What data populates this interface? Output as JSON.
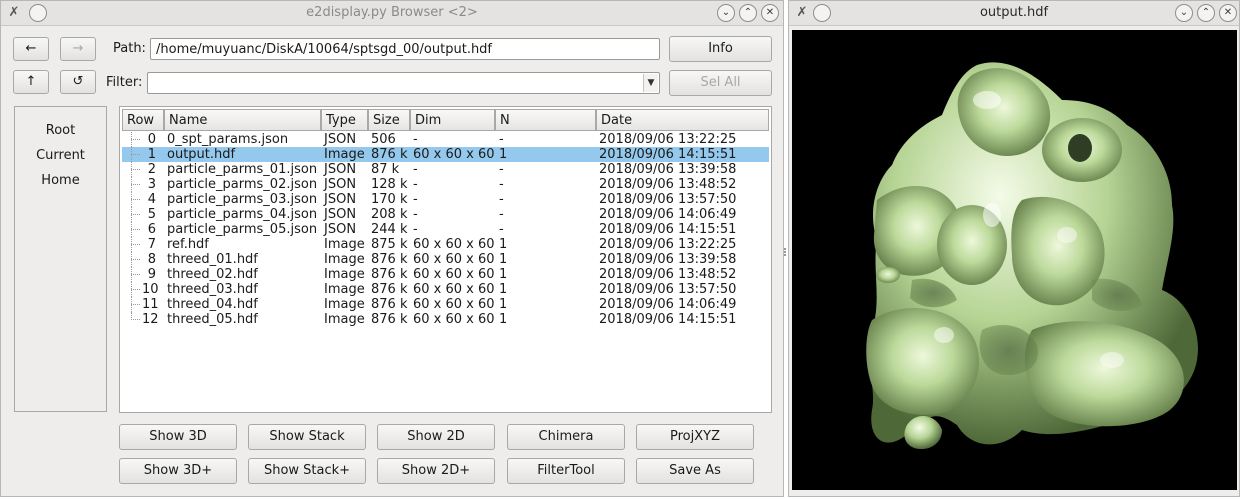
{
  "browser": {
    "title": "e2display.py Browser <2>",
    "back_icon": "←",
    "forward_icon": "→",
    "up_icon": "↑",
    "refresh_icon": "↺",
    "path_label": "Path:",
    "path_value": "/home/muyuanc/DiskA/10064/sptsgd_00/output.hdf",
    "info_label": "Info",
    "filter_label": "Filter:",
    "filter_value": "",
    "sel_all_label": "Sel All",
    "nav_items": [
      "Root",
      "Current",
      "Home"
    ],
    "columns": [
      "Row",
      "Name",
      "Type",
      "Size",
      "Dim",
      "N",
      "Date"
    ],
    "rows": [
      {
        "row": "0",
        "name": "0_spt_params.json",
        "type": "JSON",
        "size": "506",
        "dim": "-",
        "n": "-",
        "date": "2018/09/06 13:22:25"
      },
      {
        "row": "1",
        "name": "output.hdf",
        "type": "Image",
        "size": "876 k",
        "dim": "60 x 60 x 60",
        "n": "1",
        "date": "2018/09/06 14:15:51"
      },
      {
        "row": "2",
        "name": "particle_parms_01.json",
        "type": "JSON",
        "size": "87 k",
        "dim": "-",
        "n": "-",
        "date": "2018/09/06 13:39:58"
      },
      {
        "row": "3",
        "name": "particle_parms_02.json",
        "type": "JSON",
        "size": "128 k",
        "dim": "-",
        "n": "-",
        "date": "2018/09/06 13:48:52"
      },
      {
        "row": "4",
        "name": "particle_parms_03.json",
        "type": "JSON",
        "size": "170 k",
        "dim": "-",
        "n": "-",
        "date": "2018/09/06 13:57:50"
      },
      {
        "row": "5",
        "name": "particle_parms_04.json",
        "type": "JSON",
        "size": "208 k",
        "dim": "-",
        "n": "-",
        "date": "2018/09/06 14:06:49"
      },
      {
        "row": "6",
        "name": "particle_parms_05.json",
        "type": "JSON",
        "size": "244 k",
        "dim": "-",
        "n": "-",
        "date": "2018/09/06 14:15:51"
      },
      {
        "row": "7",
        "name": "ref.hdf",
        "type": "Image",
        "size": "875 k",
        "dim": "60 x 60 x 60",
        "n": "1",
        "date": "2018/09/06 13:22:25"
      },
      {
        "row": "8",
        "name": "threed_01.hdf",
        "type": "Image",
        "size": "876 k",
        "dim": "60 x 60 x 60",
        "n": "1",
        "date": "2018/09/06 13:39:58"
      },
      {
        "row": "9",
        "name": "threed_02.hdf",
        "type": "Image",
        "size": "876 k",
        "dim": "60 x 60 x 60",
        "n": "1",
        "date": "2018/09/06 13:48:52"
      },
      {
        "row": "10",
        "name": "threed_03.hdf",
        "type": "Image",
        "size": "876 k",
        "dim": "60 x 60 x 60",
        "n": "1",
        "date": "2018/09/06 13:57:50"
      },
      {
        "row": "11",
        "name": "threed_04.hdf",
        "type": "Image",
        "size": "876 k",
        "dim": "60 x 60 x 60",
        "n": "1",
        "date": "2018/09/06 14:06:49"
      },
      {
        "row": "12",
        "name": "threed_05.hdf",
        "type": "Image",
        "size": "876 k",
        "dim": "60 x 60 x 60",
        "n": "1",
        "date": "2018/09/06 14:15:51"
      }
    ],
    "selected_row": 1,
    "action_buttons_row1": [
      "Show 3D",
      "Show Stack",
      "Show 2D",
      "Chimera",
      "ProjXYZ"
    ],
    "action_buttons_row2": [
      "Show 3D+",
      "Show Stack+",
      "Show 2D+",
      "FilterTool",
      "Save As"
    ]
  },
  "viewer": {
    "title": "output.hdf",
    "background_color": "#000000",
    "surface_color": "#bcd99a"
  },
  "titlebar_icons": [
    "app-icon",
    "pin-icon",
    "minimize-icon",
    "maximize-icon",
    "close-icon"
  ],
  "colors": {
    "selection": "#94c8ec",
    "window_bg": "#eeedec"
  }
}
